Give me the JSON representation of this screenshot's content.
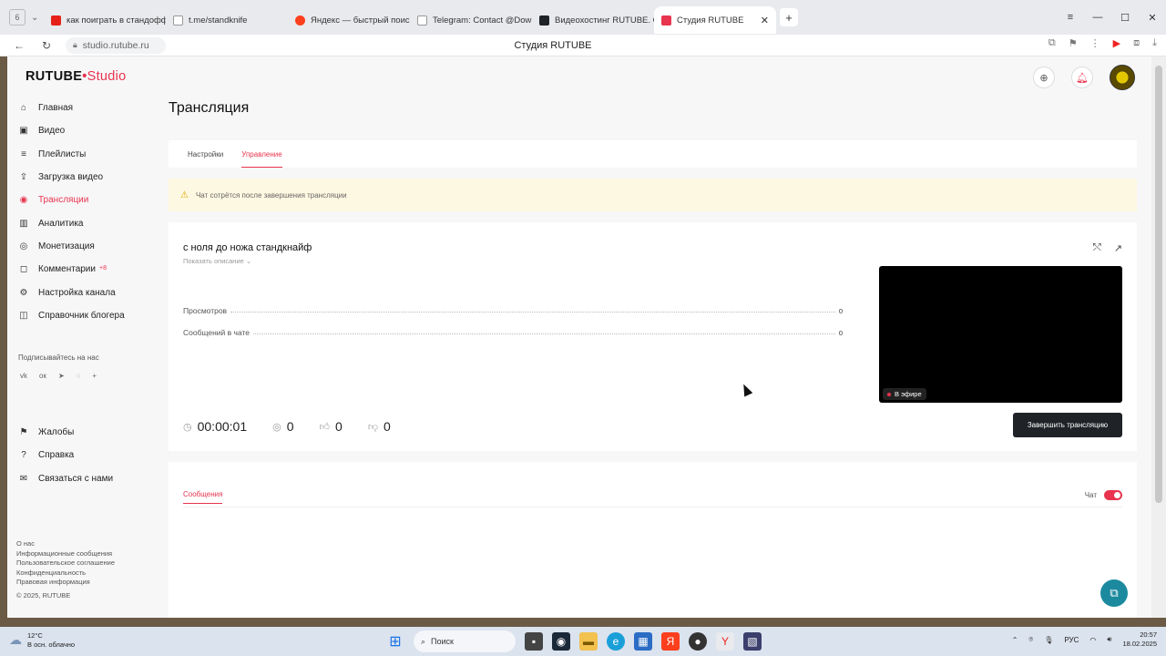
{
  "browser": {
    "tab_count": "6",
    "tabs": [
      {
        "label": "как поиграть в стандофф",
        "color": "#e62117"
      },
      {
        "label": "t.me/standknife",
        "color": "#999999"
      },
      {
        "label": "Яндекс — быстрый поиск",
        "color": "#fc3f1d"
      },
      {
        "label": "Telegram: Contact @Dow",
        "color": "#999999"
      },
      {
        "label": "Видеохостинг RUTUBE. С",
        "color": "#1f2328"
      },
      {
        "label": "Студия RUTUBE",
        "color": "#e8344e"
      }
    ],
    "url": "studio.rutube.ru",
    "page_title": "Студия RUTUBE"
  },
  "logo": {
    "brand": "RUTUBE",
    "product": "Studio"
  },
  "sidebar": {
    "items": [
      {
        "label": "Главная",
        "icon": "home-icon",
        "glyph": "⌂"
      },
      {
        "label": "Видео",
        "icon": "video-icon",
        "glyph": "▣"
      },
      {
        "label": "Плейлисты",
        "icon": "playlist-icon",
        "glyph": "≡"
      },
      {
        "label": "Загрузка видео",
        "icon": "upload-icon",
        "glyph": "⇪"
      },
      {
        "label": "Трансляции",
        "icon": "broadcast-icon",
        "glyph": "◉"
      },
      {
        "label": "Аналитика",
        "icon": "analytics-icon",
        "glyph": "▥"
      },
      {
        "label": "Монетизация",
        "icon": "money-icon",
        "glyph": "◎"
      },
      {
        "label": "Комментарии",
        "icon": "comment-icon",
        "glyph": "◻",
        "badge": "+8"
      },
      {
        "label": "Настройка канала",
        "icon": "gear-icon",
        "glyph": "⚙"
      },
      {
        "label": "Справочник блогера",
        "icon": "book-icon",
        "glyph": "◫"
      }
    ],
    "subscribe_label": "Подписывайтесь на нас",
    "socials": [
      {
        "label": "vk",
        "icon": "vk-icon"
      },
      {
        "label": "ok",
        "icon": "ok-icon"
      },
      {
        "label": "telegram",
        "icon": "telegram-icon"
      },
      {
        "label": "viber",
        "icon": "viber-icon"
      },
      {
        "label": "more",
        "icon": "plus-icon"
      }
    ],
    "bottom_items": [
      {
        "label": "Жалобы",
        "icon": "flag-icon",
        "glyph": "⚑"
      },
      {
        "label": "Справка",
        "icon": "help-icon",
        "glyph": "?"
      },
      {
        "label": "Связаться с нами",
        "icon": "mail-icon",
        "glyph": "✉"
      }
    ],
    "footer_links": [
      "О нас",
      "Информационные сообщения",
      "Пользовательское соглашение",
      "Конфиденциальность",
      "Правовая информация"
    ],
    "copyright": "© 2025, RUTUBE"
  },
  "main": {
    "title": "Трансляция",
    "tabs": [
      {
        "label": "Настройки"
      },
      {
        "label": "Управление"
      }
    ],
    "warning": "Чат сотрётся после завершения трансляции",
    "stream": {
      "title": "с ноля до ножа стандкнайф",
      "show_description": "Показать описание ⌄",
      "stats": [
        {
          "label": "Просмотров",
          "value": "0"
        },
        {
          "label": "Сообщений в чате",
          "value": "0"
        }
      ],
      "live_label": "В эфире",
      "duration": "00:00:01",
      "viewers": "0",
      "likes": "0",
      "dislikes": "0",
      "end_button": "Завершить трансляцию"
    },
    "chat": {
      "tab": "Сообщения",
      "toggle_label": "Чат",
      "enabled": true
    }
  },
  "taskbar": {
    "weather_temp": "12°C",
    "weather_desc": "В осн. облачно",
    "search_placeholder": "Поиск",
    "lang": "РУС",
    "time": "20:57",
    "date": "18.02.2025"
  },
  "colors": {
    "accent": "#e8344e",
    "button_dark": "#1f2328",
    "warning_bg": "#fdf8e1"
  }
}
